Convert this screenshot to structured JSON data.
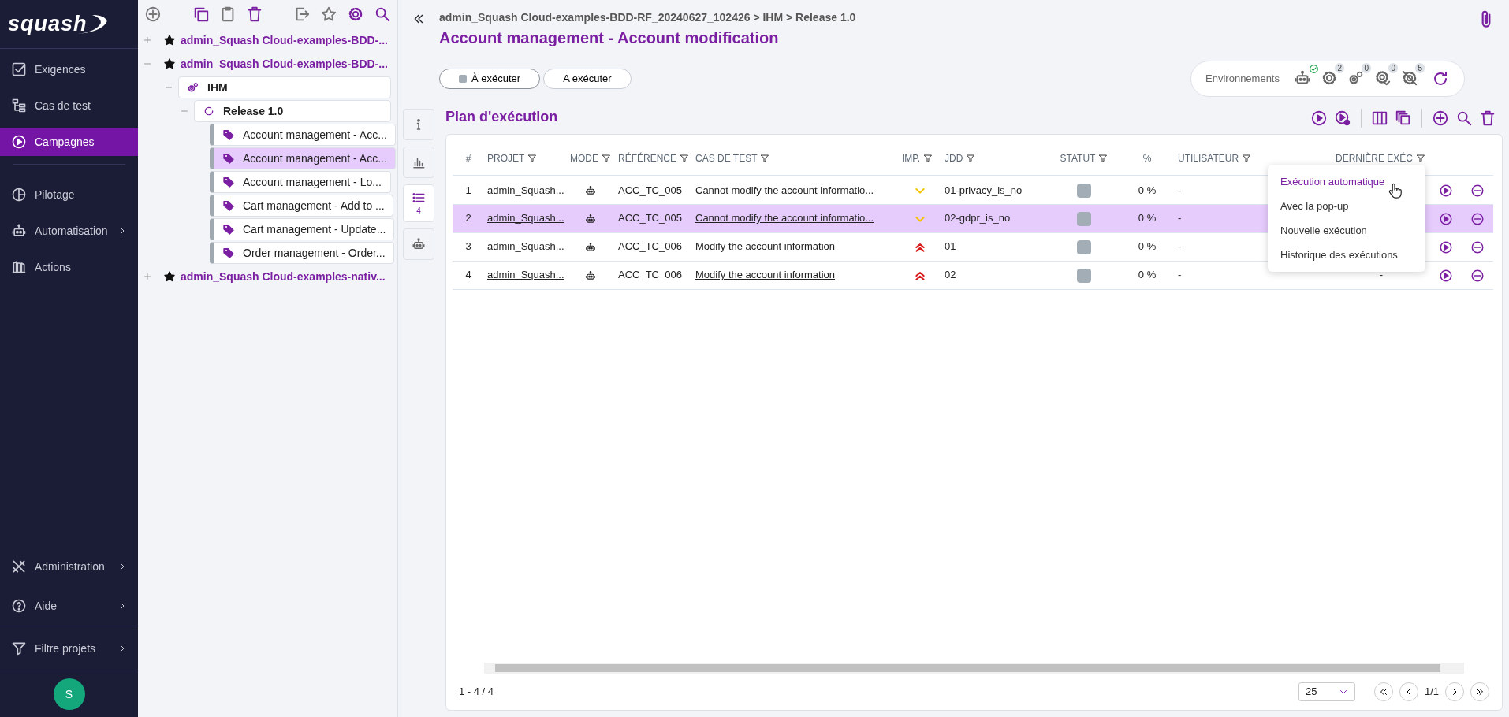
{
  "logo": "squash",
  "nav": [
    {
      "label": "Exigences",
      "selected": false,
      "submenu": false
    },
    {
      "label": "Cas de test",
      "selected": false,
      "submenu": false
    },
    {
      "label": "Campagnes",
      "selected": true,
      "submenu": false
    },
    {
      "label": "Pilotage",
      "selected": false,
      "submenu": false
    },
    {
      "label": "Automatisation",
      "selected": false,
      "submenu": true
    },
    {
      "label": "Actions",
      "selected": false,
      "submenu": false
    }
  ],
  "nav_bottom": [
    {
      "label": "Administration",
      "submenu": true
    },
    {
      "label": "Aide",
      "submenu": true
    },
    {
      "label": "Filtre projets",
      "submenu": true
    }
  ],
  "user_avatar": "S",
  "tree": [
    {
      "kind": "project",
      "label": "admin_Squash Cloud-examples-BDD-...",
      "expanded": false,
      "selected": false
    },
    {
      "kind": "project",
      "label": "admin_Squash Cloud-examples-BDD-...",
      "expanded": true,
      "selected": false,
      "children": [
        {
          "kind": "iteration",
          "label": "IHM",
          "expanded": true,
          "selected": false,
          "children": [
            {
              "kind": "release",
              "label": "Release 1.0",
              "expanded": true,
              "selected": false,
              "children": [
                {
                  "kind": "suite",
                  "label": "Account management - Acc...",
                  "selected": false
                },
                {
                  "kind": "suite",
                  "label": "Account management - Acc...",
                  "selected": true
                },
                {
                  "kind": "suite",
                  "label": "Account management - Lo...",
                  "selected": false
                },
                {
                  "kind": "suite",
                  "label": "Cart management - Add to ...",
                  "selected": false
                },
                {
                  "kind": "suite",
                  "label": "Cart management - Update...",
                  "selected": false
                },
                {
                  "kind": "suite",
                  "label": "Order management - Order...",
                  "selected": false
                }
              ]
            }
          ]
        }
      ]
    },
    {
      "kind": "project",
      "label": "admin_Squash Cloud-examples-nativ...",
      "expanded": false,
      "selected": false
    }
  ],
  "side_tabs": [
    {
      "kind": "info",
      "selected": false
    },
    {
      "kind": "chart",
      "selected": false
    },
    {
      "kind": "list",
      "selected": true,
      "count": "4"
    },
    {
      "kind": "robot",
      "selected": false
    }
  ],
  "breadcrumb": "admin_Squash Cloud-examples-BDD-RF_20240627_102426 > IHM > Release 1.0",
  "title": "Account management - Account modification",
  "status_pills": [
    {
      "label": "À exécuter",
      "selected": true,
      "color": "#a3adb5"
    },
    {
      "label": "A exécuter",
      "selected": false
    }
  ],
  "environments": {
    "label": "Environnements",
    "items": [
      {
        "kind": "robot",
        "ok": true
      },
      {
        "kind": "gear",
        "badge": "2"
      },
      {
        "kind": "gears",
        "badge": "0"
      },
      {
        "kind": "gear-check",
        "badge": "0"
      },
      {
        "kind": "gear-off",
        "badge": "5"
      }
    ]
  },
  "plan": {
    "title": "Plan d'exécution",
    "columns": [
      {
        "label": "#",
        "filter": false
      },
      {
        "label": "PROJET",
        "filter": true
      },
      {
        "label": "MODE",
        "filter": true
      },
      {
        "label": "RÉFÉRENCE",
        "filter": true
      },
      {
        "label": "CAS DE TEST",
        "filter": true
      },
      {
        "label": "IMP.",
        "filter": true
      },
      {
        "label": "JDD",
        "filter": true
      },
      {
        "label": "STATUT",
        "filter": true
      },
      {
        "label": "%",
        "filter": false
      },
      {
        "label": "UTILISATEUR",
        "filter": true
      },
      {
        "label": "DERNIÈRE EXÉC",
        "filter": true
      }
    ],
    "rows": [
      {
        "num": "1",
        "project": "admin_Squash...",
        "reference": "ACC_TC_005",
        "test_case": "Cannot modify the account informatio...",
        "importance": {
          "kind": "low"
        },
        "dataset": "01-privacy_is_no",
        "status": {
          "color": "#a3adb5"
        },
        "percent": "0 %",
        "user": "-",
        "selected": false
      },
      {
        "num": "2",
        "project": "admin_Squash...",
        "reference": "ACC_TC_005",
        "test_case": "Cannot modify the account informatio...",
        "importance": {
          "kind": "low"
        },
        "dataset": "02-gdpr_is_no",
        "status": {
          "color": "#a3adb5"
        },
        "percent": "0 %",
        "user": "-",
        "selected": true
      },
      {
        "num": "3",
        "project": "admin_Squash...",
        "reference": "ACC_TC_006",
        "test_case": "Modify the account information",
        "importance": {
          "kind": "high"
        },
        "dataset": "01",
        "status": {
          "color": "#a3adb5"
        },
        "percent": "0 %",
        "user": "-",
        "selected": false
      },
      {
        "num": "4",
        "project": "admin_Squash...",
        "reference": "ACC_TC_006",
        "test_case": "Modify the account information",
        "importance": {
          "kind": "high"
        },
        "dataset": "02",
        "status": {
          "color": "#a3adb5"
        },
        "percent": "0 %",
        "user": "-",
        "last_execution": "-",
        "selected": false
      }
    ],
    "menu": [
      {
        "label": "Exécution automatique",
        "selected": true
      },
      {
        "label": "Avec la pop-up",
        "selected": false
      },
      {
        "label": "Nouvelle exécution",
        "selected": false
      },
      {
        "label": "Historique des exécutions",
        "selected": false
      }
    ],
    "range": "1 - 4 / 4",
    "page_size": "25",
    "page": "1/1"
  }
}
